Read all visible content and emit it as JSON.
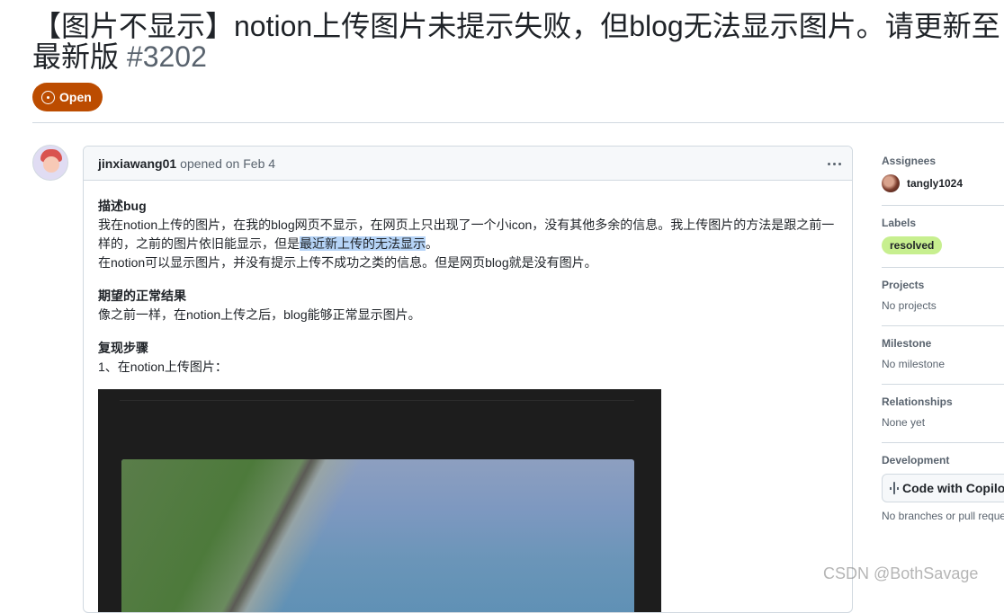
{
  "issue": {
    "title": "【图片不显示】notion上传图片未提示失败，但blog无法显示图片。请更新至最新版",
    "number": "#3202",
    "state": "Open"
  },
  "comment": {
    "author": "jinxiawang01",
    "meta": "opened on Feb 4",
    "sections": [
      {
        "heading": "描述bug",
        "line1_pre": "我在notion上传的图片，在我的blog网页不显示，在网页上只出现了一个小icon，没有其他多余的信息。我上传图片的方法是跟之前一样的，之前的图片依旧能显示，但是",
        "line1_highlight": "最近新上传的无法显示",
        "line1_post": "。",
        "line2": "在notion可以显示图片，并没有提示上传不成功之类的信息。但是网页blog就是没有图片。"
      },
      {
        "heading": "期望的正常结果",
        "line1": "像之前一样，在notion上传之后，blog能够正常显示图片。"
      },
      {
        "heading": "复现步骤",
        "line1": "1、在notion上传图片："
      }
    ]
  },
  "sidebar": {
    "assignees": {
      "title": "Assignees",
      "value": "tangly1024"
    },
    "labels": {
      "title": "Labels",
      "value": "resolved",
      "color": "#c7ef8f"
    },
    "projects": {
      "title": "Projects",
      "value": "No projects"
    },
    "milestone": {
      "title": "Milestone",
      "value": "No milestone"
    },
    "relationships": {
      "title": "Relationships",
      "value": "None yet"
    },
    "development": {
      "title": "Development",
      "button": "Code with Copilot",
      "note": "No branches or pull requests"
    }
  },
  "watermark": "CSDN @BothSavage",
  "colors": {
    "state_badge": "#bc4c00",
    "border": "#d1d9e0",
    "muted_text": "#59636e"
  }
}
